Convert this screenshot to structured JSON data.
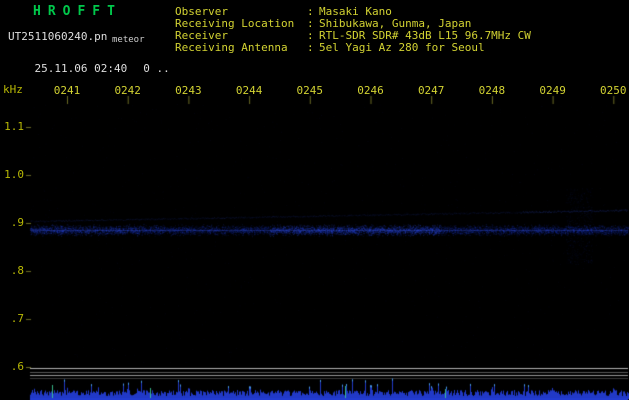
{
  "header": {
    "app_title": "HROFFT",
    "filename": "UT2511060240.pn",
    "mode": "meteor",
    "datetime": "25.11.06 02:40",
    "counter": "0 ..",
    "separator": ":",
    "info": [
      {
        "label": "Observer",
        "value": "Masaki Kano"
      },
      {
        "label": "Receiving Location",
        "value": "Shibukawa, Gunma, Japan"
      },
      {
        "label": "Receiver",
        "value": "RTL-SDR SDR# 43dB L15 96.7MHz CW"
      },
      {
        "label": "Receiving Antenna",
        "value": "5el Yagi Az 280 for Seoul"
      }
    ]
  },
  "chart_data": {
    "type": "heatmap",
    "title": "HROFFT 10-minute radio meteor spectrogram",
    "xlabel": "",
    "ylabel": "kHz",
    "x_ticks": [
      "0241",
      "0242",
      "0243",
      "0244",
      "0245",
      "0246",
      "0247",
      "0248",
      "0249",
      "0250"
    ],
    "y_ticks": [
      "1.1",
      "1.0",
      ".9",
      ".8",
      ".7",
      ".6"
    ],
    "ylim": [
      0.6,
      1.15
    ],
    "xlim_ut": [
      "0240",
      "0250"
    ],
    "grid": false,
    "legend": false,
    "features": [
      {
        "name": "carrier-band",
        "freq_khz": 0.89,
        "time_span": "full width",
        "appearance": "continuous faint blue noise band"
      },
      {
        "name": "drifting-trace",
        "freq_khz_start": 0.91,
        "freq_khz_end": 0.935,
        "appearance": "very faint diagonal trace rising to the right"
      },
      {
        "name": "noise-smudge",
        "time_ut": "0249",
        "freq_khz": 0.9,
        "appearance": "faint vertical blue smudge near right edge"
      },
      {
        "name": "signal-level-strip",
        "location": "bottom",
        "appearance": "blue jagged noise floor under gray reference lines"
      }
    ],
    "colors": {
      "background": "#000000",
      "title_green": "#00c84b",
      "header_yellow": "#d2d232",
      "axis_yellow": "#b9b905",
      "text_white": "#dedede",
      "signal_blue": "#2d4be6"
    }
  }
}
